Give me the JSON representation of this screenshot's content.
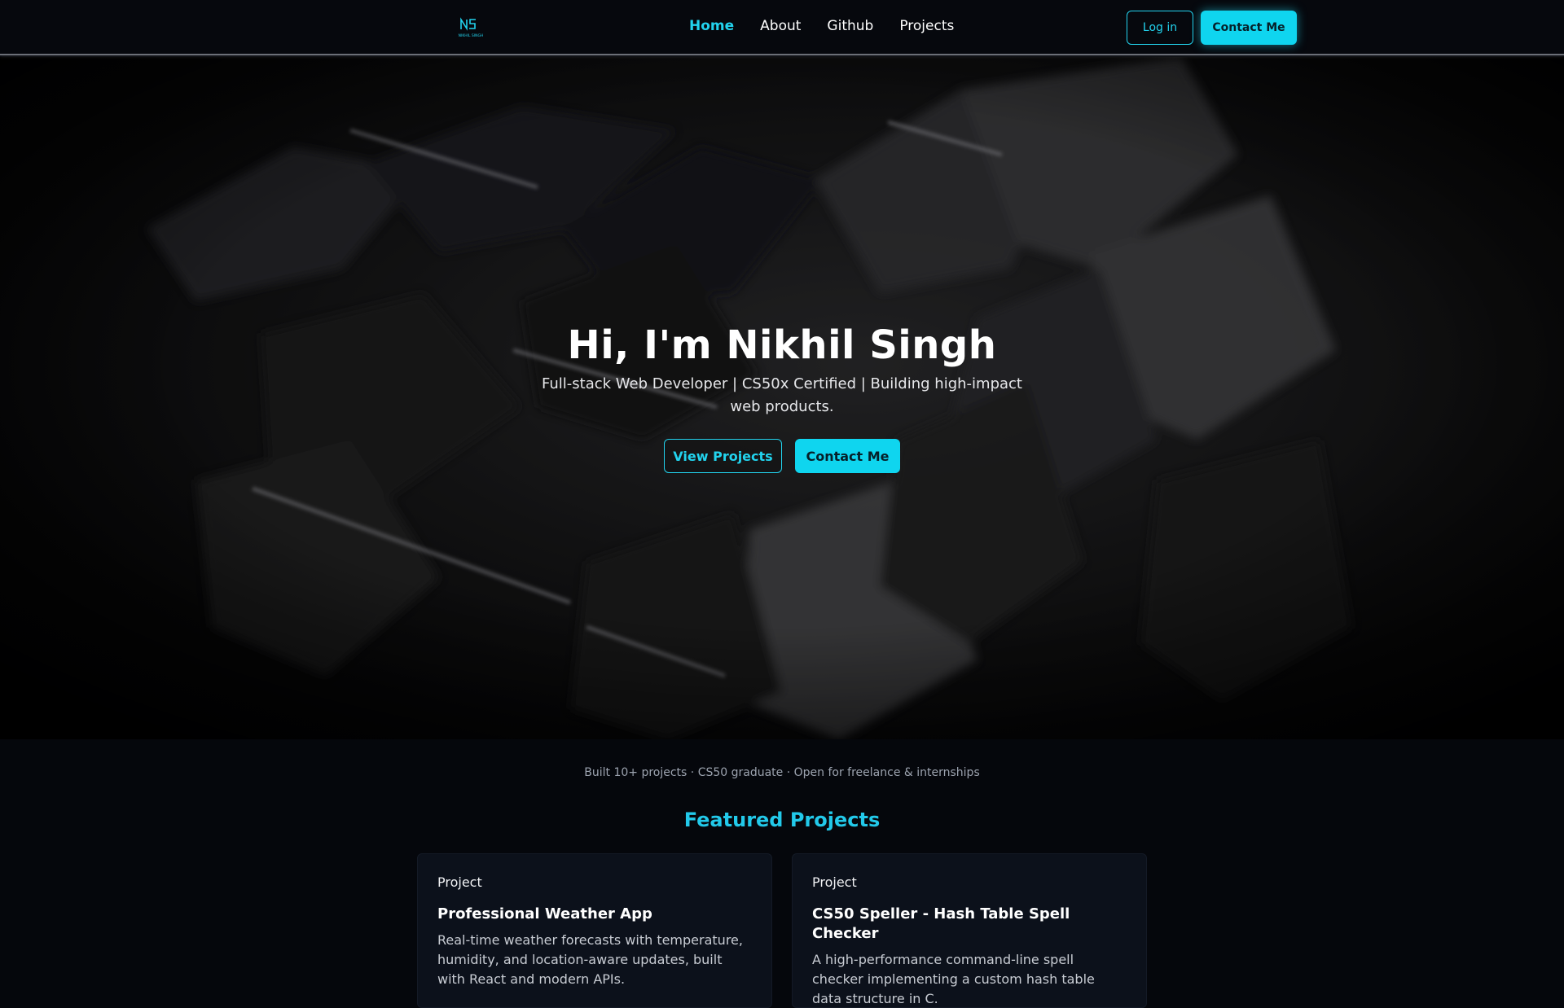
{
  "nav": {
    "logo_icon": "ns-logo-icon",
    "logo_text": "NS",
    "logo_subtext": "NIKHIL SINGH",
    "links": [
      {
        "label": "Home",
        "active": true
      },
      {
        "label": "About",
        "active": false
      },
      {
        "label": "Github",
        "active": false
      },
      {
        "label": "Projects",
        "active": false
      }
    ],
    "login_label": "Log in",
    "contact_label": "Contact Me"
  },
  "hero": {
    "title": "Hi, I'm Nikhil Singh",
    "subtitle": "Full-stack Web Developer | CS50x Certified | Building high-impact web products.",
    "view_projects_label": "View Projects",
    "contact_label": "Contact Me",
    "background": "rubiks-cube-image"
  },
  "stats": "Built 10+ projects · CS50 graduate · Open for freelance & internships",
  "featured": {
    "title": "Featured Projects",
    "projects": [
      {
        "tag": "Project",
        "title": "Professional Weather App",
        "description": "Real-time weather forecasts with temperature, humidity, and location-aware updates, built with React and modern APIs."
      },
      {
        "tag": "Project",
        "title": "CS50 Speller - Hash Table Spell Checker",
        "description": "A high-performance command-line spell checker implementing a custom hash table data structure in C."
      }
    ]
  },
  "colors": {
    "accent": "#22d3ee",
    "background": "#05070c",
    "card": "#0c111b"
  }
}
